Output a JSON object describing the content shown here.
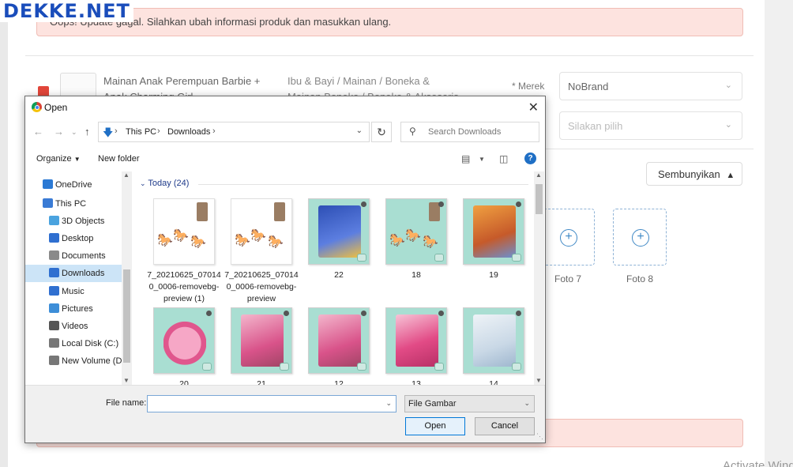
{
  "site": {
    "logo": "DEKKE.NET",
    "alert_text": "Oops! Update gagal. Silahkan ubah informasi produk dan masukkan ulang.",
    "product_name": "Mainan Anak Perempuan Barbie + Anak Charming Girl",
    "category": "Ibu & Bayi / Mainan / Boneka & Mainan Boneka / Boneka & Aksesoris",
    "merek_label": "* Merek",
    "brand_value": "NoBrand",
    "select_placeholder": "Silakan pilih",
    "hide_button": "Sembunyikan",
    "photo_labels": [
      "Foto 7",
      "Foto 8"
    ],
    "watermark": "Activate Windows"
  },
  "dialog": {
    "title": "Open",
    "breadcrumb": [
      "This PC",
      "Downloads"
    ],
    "search_placeholder": "Search Downloads",
    "organize_label": "Organize",
    "new_folder_label": "New folder",
    "nav_items": [
      {
        "label": "OneDrive",
        "icon": "cloud-icon",
        "color": "#2b79d4"
      },
      {
        "label": "This PC",
        "icon": "computer-icon",
        "color": "#3a7bd5"
      },
      {
        "label": "3D Objects",
        "icon": "cube-icon",
        "color": "#4aa3df"
      },
      {
        "label": "Desktop",
        "icon": "desktop-icon",
        "color": "#2f6fd0"
      },
      {
        "label": "Documents",
        "icon": "document-icon",
        "color": "#8a8a8a"
      },
      {
        "label": "Downloads",
        "icon": "download-icon",
        "color": "#2f6fd0"
      },
      {
        "label": "Music",
        "icon": "music-icon",
        "color": "#2f6fd0"
      },
      {
        "label": "Pictures",
        "icon": "pictures-icon",
        "color": "#3d8ed8"
      },
      {
        "label": "Videos",
        "icon": "video-icon",
        "color": "#555555"
      },
      {
        "label": "Local Disk (C:)",
        "icon": "disk-icon",
        "color": "#777777"
      },
      {
        "label": "New Volume (D:)",
        "icon": "drive-icon",
        "color": "#777777"
      }
    ],
    "selected_nav": "Downloads",
    "group_header": "Today (24)",
    "files": [
      {
        "name": "7_20210625_070140_0006-removebg-preview (1)",
        "style": "horses"
      },
      {
        "name": "7_20210625_070140_0006-removebg-preview",
        "style": "horses"
      },
      {
        "name": "22",
        "style": "teal-blue"
      },
      {
        "name": "18",
        "style": "teal-horses"
      },
      {
        "name": "19",
        "style": "teal-orange"
      },
      {
        "name": "20",
        "style": "teal-pink"
      },
      {
        "name": "21",
        "style": "teal-doll"
      },
      {
        "name": "12",
        "style": "teal-doll"
      },
      {
        "name": "13",
        "style": "teal-doll2"
      },
      {
        "name": "14",
        "style": "teal-white"
      }
    ],
    "file_name_label": "File name:",
    "file_name_value": "",
    "file_type": "File Gambar",
    "open_label": "Open",
    "cancel_label": "Cancel"
  },
  "colors": {
    "accent": "#0078d7",
    "alert_bg": "#fde3df",
    "logo_blue": "#1a4dbb",
    "thumb_teal": "#a9ded2"
  }
}
